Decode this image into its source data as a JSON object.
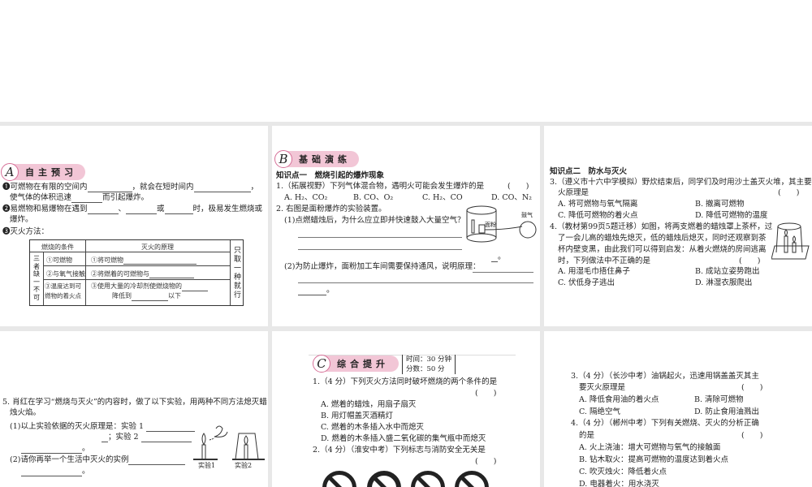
{
  "p1": {
    "badge_letter": "A",
    "badge": "自主预习",
    "q1a": "❶可燃物在有限的空间内",
    "q1b": "，就会在短时间内",
    "q1c": "，",
    "q1d": "使气体的体积迅速",
    "q1e": "而引起爆炸。",
    "q2a": "❷易燃物和易爆物在遇到",
    "q2b": "、",
    "q2c": "或",
    "q2d": "时，极易发生燃烧或",
    "q2e": "爆炸。",
    "q3": "❸灭火方法：",
    "table": {
      "h1": "燃烧的条件",
      "h2": "灭火的原理",
      "side_left": "三者缺一不可",
      "side_right": "只取一种就行",
      "r1a": "①可燃物",
      "r1b": "①将可燃物",
      "r2a": "②与氧气接触",
      "r2b": "②将燃着的可燃物与",
      "r3a": "③温度达到可燃物的着火点",
      "r3b": "③使用大量的冷却剂使燃烧物的",
      "r3c": "降低到",
      "r3d": "以下"
    }
  },
  "p2": {
    "badge_letter": "B",
    "badge": "基础演练",
    "kp": "知识点一　燃烧引起的爆炸现象",
    "q1": "1.（拓展视野）下列气体混合物，遇明火可能会发生爆炸的是",
    "paren": "(　　)",
    "q1opts": [
      "A. H₂、CO₂",
      "B. CO、O₂",
      "C. H₂、CO",
      "D. CO、N₂"
    ],
    "q2": "2. 右图是面粉爆炸的实验装置。",
    "q2_1": "(1)点燃蜡烛后，为什么应立即并快速鼓入大量空气？",
    "end": "。",
    "q2_2": "(2)为防止爆炸，面粉加工车间需要保持通风，说明原理：",
    "fig_flour": "面粉",
    "fig_air": "鼓气"
  },
  "p3": {
    "kp": "知识点二　防水与灭火",
    "q3a": "3.（遵义市十六中学模拟）野炊结束后，同学们及时用沙土盖灭火堆，其主要灭",
    "q3b": "火原理是",
    "paren": "(　　)",
    "q3opts": [
      "A. 将可燃物与氧气隔离",
      "B. 撤离可燃物",
      "C. 降低可燃物的着火点",
      "D. 降低可燃物的温度"
    ],
    "q4a": "4.（教材第99页5题迁移）如图，将两支燃着的蜡烛罩上茶杯，过",
    "q4b": "了一会儿高的蜡烛先熄灭，低的蜡烛后熄灭，同时还观察到茶",
    "q4c": "杯内壁变黑，由此我们可以得到启发：从着火燃烧的房间逃离",
    "q4d": "时，下列做法中不正确的是",
    "q4opts": [
      "A. 用湿毛巾捂住鼻子",
      "B. 成站立姿势跑出",
      "C. 伏低身子逃出",
      "D. 淋湿衣服爬出"
    ]
  },
  "p4": {
    "q5a": "5. 肖红在学习“燃烧与灭火”的内容时，做了以下实验，用两种不同方法熄灭蜡",
    "q5b": "烛火焰。",
    "q5_1a": "(1)以上实验依据的灭火原理是：实验 1",
    "q5_1b": "；实验 2",
    "end": "。",
    "q5_2": "(2)请你再举一个生活中灭火的实例",
    "fig1": "实验1",
    "fig2": "实验2"
  },
  "p5": {
    "badge_letter": "C",
    "badge": "综合提升",
    "time": "时间：30 分钟",
    "score": "分数：50 分",
    "q1": "1.（4 分）下列灭火方法同时破坏燃烧的两个条件的是",
    "paren": "(　　)",
    "q1opts": [
      "A. 燃着的蜡烛，用扇子扇灭",
      "B. 用灯帽盖灭酒精灯",
      "C. 燃着的木条插入水中而熄灭",
      "D. 燃着的木条插入盛二氧化碳的集气瓶中而熄灭"
    ],
    "q2": "2.（4 分）（淮安中考）下列标志与消防安全无关是"
  },
  "p6": {
    "q3a": "3.（4 分）（长沙中考）油锅起火，迅速用锅盖盖灭其主",
    "q3b": "要灭火原理是",
    "paren": "(　　)",
    "q3opts": [
      "A. 降低食用油的着火点",
      "B. 清除可燃物",
      "C. 隔绝空气",
      "D. 防止食用油溅出"
    ],
    "q4a": "4.（4 分）（郴州中考）下列有关燃烧、灭火的分析正确",
    "q4b": "的是",
    "q4opts": [
      "A. 火上浇油：增大可燃物与氧气的接触面",
      "B. 钻木取火：提高可燃物的温度达到着火点",
      "C. 吹灭烛火：降低着火点",
      "D. 电器着火：用水浇灭"
    ]
  }
}
